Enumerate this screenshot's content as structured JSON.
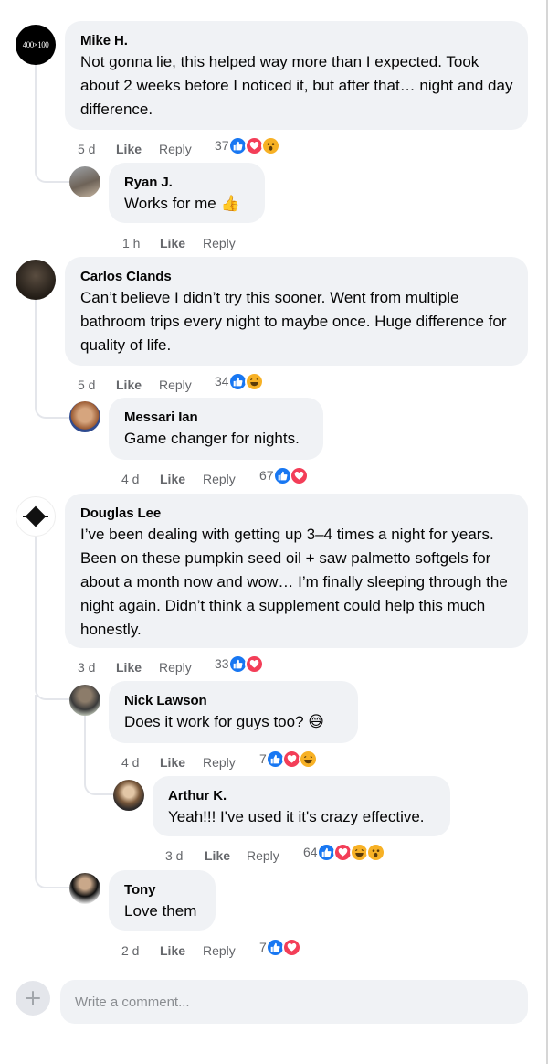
{
  "comments": [
    {
      "name": "Mike H.",
      "avatar_text": "400×100",
      "text": "Not gonna lie, this helped way more than I expected. Took about 2 weeks before I noticed it, but after that… night and day difference.",
      "time": "5 d",
      "like": "Like",
      "reply": "Reply",
      "reaction_count": "37",
      "reactions": [
        "like",
        "love",
        "wow"
      ]
    },
    {
      "name": "Ryan J.",
      "text": "Works for me 👍",
      "time": "1 h",
      "like": "Like",
      "reply": "Reply"
    },
    {
      "name": "Carlos Clands",
      "text": "Can’t believe I didn’t try this sooner. Went from multiple bathroom trips every night to maybe once. Huge difference for quality of life.",
      "time": "5 d",
      "like": "Like",
      "reply": "Reply",
      "reaction_count": "34",
      "reactions": [
        "like",
        "haha"
      ]
    },
    {
      "name": "Messari Ian",
      "text": "Game changer for nights.",
      "time": "4 d",
      "like": "Like",
      "reply": "Reply",
      "reaction_count": "67",
      "reactions": [
        "like",
        "love"
      ]
    },
    {
      "name": "Douglas Lee",
      "text": "I’ve been dealing with getting up 3–4 times a night for years. Been on these pumpkin seed oil + saw palmetto softgels for about a month now and wow… I’m finally sleeping through the night again. Didn’t think a supplement could help this much honestly.",
      "time": "3 d",
      "like": "Like",
      "reply": "Reply",
      "reaction_count": "33",
      "reactions": [
        "like",
        "love"
      ]
    },
    {
      "name": "Nick Lawson",
      "text": "Does it work for guys too? 😅",
      "time": "4 d",
      "like": "Like",
      "reply": "Reply",
      "reaction_count": "7",
      "reactions": [
        "like",
        "love",
        "haha"
      ]
    },
    {
      "name": "Arthur K.",
      "text": "Yeah!!! I've used it it's crazy effective.",
      "time": "3 d",
      "like": "Like",
      "reply": "Reply",
      "reaction_count": "64",
      "reactions": [
        "like",
        "love",
        "haha",
        "wow"
      ]
    },
    {
      "name": "Tony",
      "text": "Love them",
      "time": "2 d",
      "like": "Like",
      "reply": "Reply",
      "reaction_count": "7",
      "reactions": [
        "like",
        "love"
      ]
    }
  ],
  "composer": {
    "placeholder": "Write a comment...",
    "add_icon": "plus-icon"
  },
  "colors": {
    "bubble": "#f0f2f5",
    "meta": "#65676b",
    "like_reaction": "#1877f2",
    "love_reaction": "#f33e58",
    "haha_reaction": "#f7b125"
  }
}
